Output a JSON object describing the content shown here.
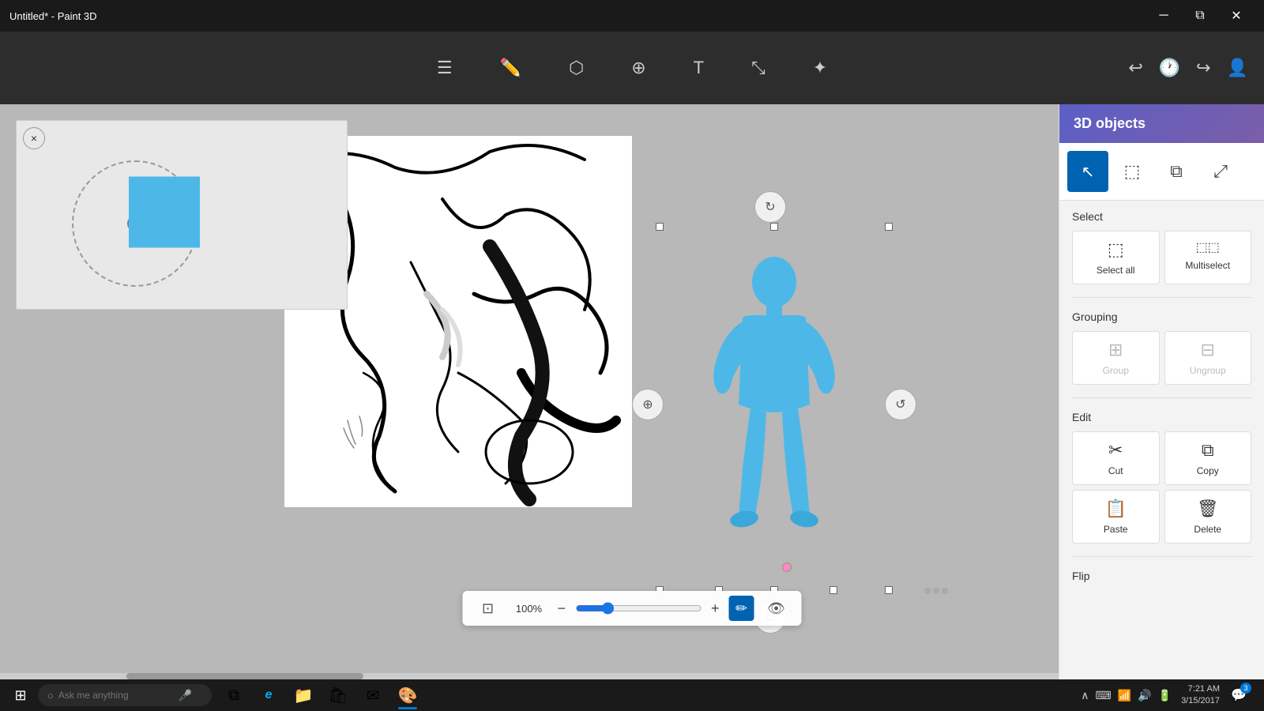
{
  "titlebar": {
    "title": "Untitled* - Paint 3D",
    "minimize": "─",
    "maximize": "⧉",
    "close": "✕"
  },
  "toolbar": {
    "brushes_label": "Brushes",
    "shapes_3d_label": "3D shapes",
    "stickers_label": "Stickers",
    "text_label": "Text",
    "canvas_label": "Canvas",
    "effects_label": "Effects",
    "undo_label": "Undo",
    "history_label": "History",
    "redo_label": "Redo",
    "account_label": "Account"
  },
  "right_panel": {
    "title": "3D objects",
    "tools": [
      {
        "id": "select",
        "icon": "cursor",
        "active": true
      },
      {
        "id": "multisel",
        "icon": "sel-box",
        "active": false
      },
      {
        "id": "copy3d",
        "icon": "copy3d",
        "active": false
      },
      {
        "id": "crop",
        "icon": "crop",
        "active": false
      }
    ],
    "select_section": {
      "title": "Select",
      "buttons": [
        {
          "id": "select-all",
          "label": "Select all",
          "icon": "⬚",
          "disabled": false
        },
        {
          "id": "multiselect",
          "label": "Multiselect",
          "icon": "⬚⬚",
          "disabled": false
        }
      ]
    },
    "grouping_section": {
      "title": "Grouping",
      "buttons": [
        {
          "id": "group",
          "label": "Group",
          "icon": "⊞",
          "disabled": true
        },
        {
          "id": "ungroup",
          "label": "Ungroup",
          "icon": "⊟",
          "disabled": true
        }
      ]
    },
    "edit_section": {
      "title": "Edit",
      "buttons": [
        {
          "id": "cut",
          "label": "Cut",
          "icon": "✂",
          "disabled": false
        },
        {
          "id": "copy",
          "label": "Copy",
          "icon": "⧉",
          "disabled": false
        },
        {
          "id": "paste",
          "label": "Paste",
          "icon": "📋",
          "disabled": false
        },
        {
          "id": "delete",
          "label": "Delete",
          "icon": "🗑",
          "disabled": false
        }
      ]
    },
    "flip_section": {
      "title": "Flip"
    }
  },
  "zoom": {
    "level": "100%",
    "min_icon": "−",
    "plus_icon": "+",
    "fit_label": "Fit",
    "eye_label": "View"
  },
  "taskbar": {
    "search_placeholder": "Ask me anything",
    "apps": [
      {
        "id": "taskview",
        "icon": "⧉",
        "active": false
      },
      {
        "id": "edge",
        "icon": "e",
        "active": false
      },
      {
        "id": "explorer",
        "icon": "📁",
        "active": false
      },
      {
        "id": "store",
        "icon": "🛍",
        "active": false
      },
      {
        "id": "mail",
        "icon": "✉",
        "active": false
      },
      {
        "id": "paint3d",
        "icon": "🎨",
        "active": true
      }
    ],
    "time": "7:21 AM",
    "date": "3/15/2017",
    "notification_count": "3"
  },
  "canvas": {
    "mini_close": "×"
  }
}
